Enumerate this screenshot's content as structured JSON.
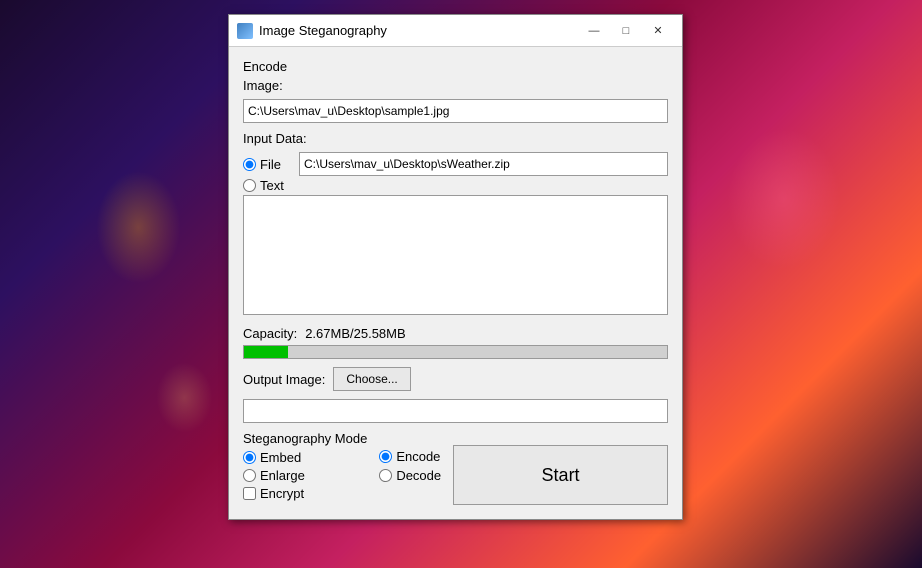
{
  "background": {
    "description": "fireworks night sky"
  },
  "window": {
    "title": "Image Steganography",
    "icon": "steganography-icon",
    "controls": {
      "minimize": "—",
      "maximize": "□",
      "close": "✕"
    },
    "encode_section": {
      "label": "Encode"
    },
    "image_label": "Image:",
    "image_path": "C:\\Users\\mav_u\\Desktop\\sample1.jpg",
    "input_data_label": "Input Data:",
    "file_radio_label": "File",
    "file_path": "C:\\Users\\mav_u\\Desktop\\sWeather.zip",
    "text_radio_label": "Text",
    "text_area_value": "",
    "capacity_label": "Capacity:",
    "capacity_value": "2.67MB/25.58MB",
    "progress_percent": 10.4,
    "output_image_label": "Output Image:",
    "choose_btn_label": "Choose...",
    "output_path": "",
    "steg_mode_title": "Steganography Mode",
    "embed_label": "Embed",
    "enlarge_label": "Enlarge",
    "encrypt_label": "Encrypt",
    "encode_radio_label": "Encode",
    "decode_radio_label": "Decode",
    "start_btn_label": "Start"
  }
}
